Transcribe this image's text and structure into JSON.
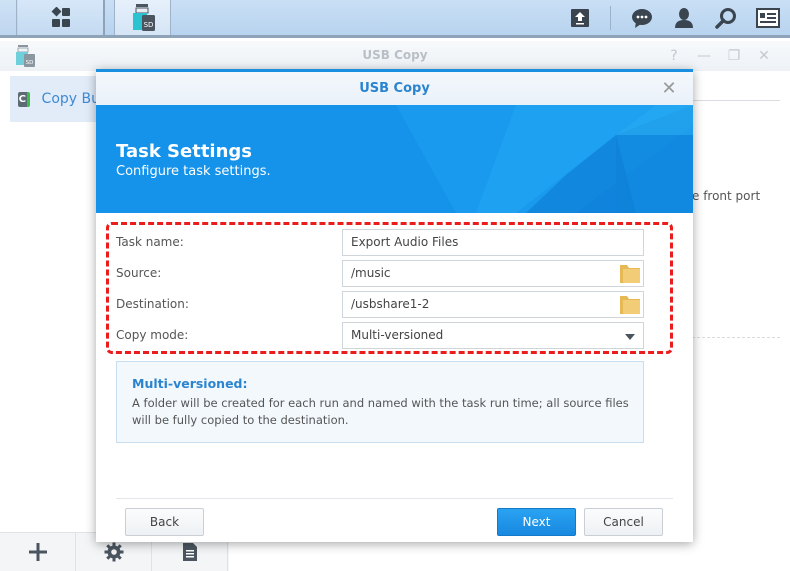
{
  "taskbar": {
    "main_menu_icon": "main-menu-icon",
    "active_app_icon": "usb-sd-icon",
    "active_app_badge": "SD",
    "right_icons": [
      "upload-icon",
      "chat-icon",
      "user-icon",
      "search-icon",
      "widget-icon"
    ]
  },
  "background_window": {
    "title": "USB Copy",
    "controls": {
      "help": "?",
      "minimize": "—",
      "maximize": "❐",
      "close": "✕"
    },
    "sidebar": {
      "items": [
        {
          "label": "Copy Bu",
          "icon_letter": "C"
        }
      ]
    },
    "partial_text": "e front port",
    "toolbar": [
      "add-icon",
      "gear-icon",
      "log-icon"
    ]
  },
  "dialog": {
    "title": "USB Copy",
    "close_label": "✕",
    "banner": {
      "title": "Task Settings",
      "subtitle": "Configure task settings."
    },
    "form": {
      "task_name": {
        "label": "Task name:",
        "value": "Export Audio Files"
      },
      "source": {
        "label": "Source:",
        "value": "/music"
      },
      "destination": {
        "label": "Destination:",
        "value": "/usbshare1-2"
      },
      "copy_mode": {
        "label": "Copy mode:",
        "value": "Multi-versioned"
      }
    },
    "info": {
      "title": "Multi-versioned:",
      "text": "A folder will be created for each run and named with the task run time; all source files will be fully copied to the destination."
    },
    "buttons": {
      "back": "Back",
      "next": "Next",
      "cancel": "Cancel"
    }
  },
  "colors": {
    "accent": "#1a8fe0",
    "highlight": "#ea1c1c",
    "folder": "#f0c66e"
  }
}
